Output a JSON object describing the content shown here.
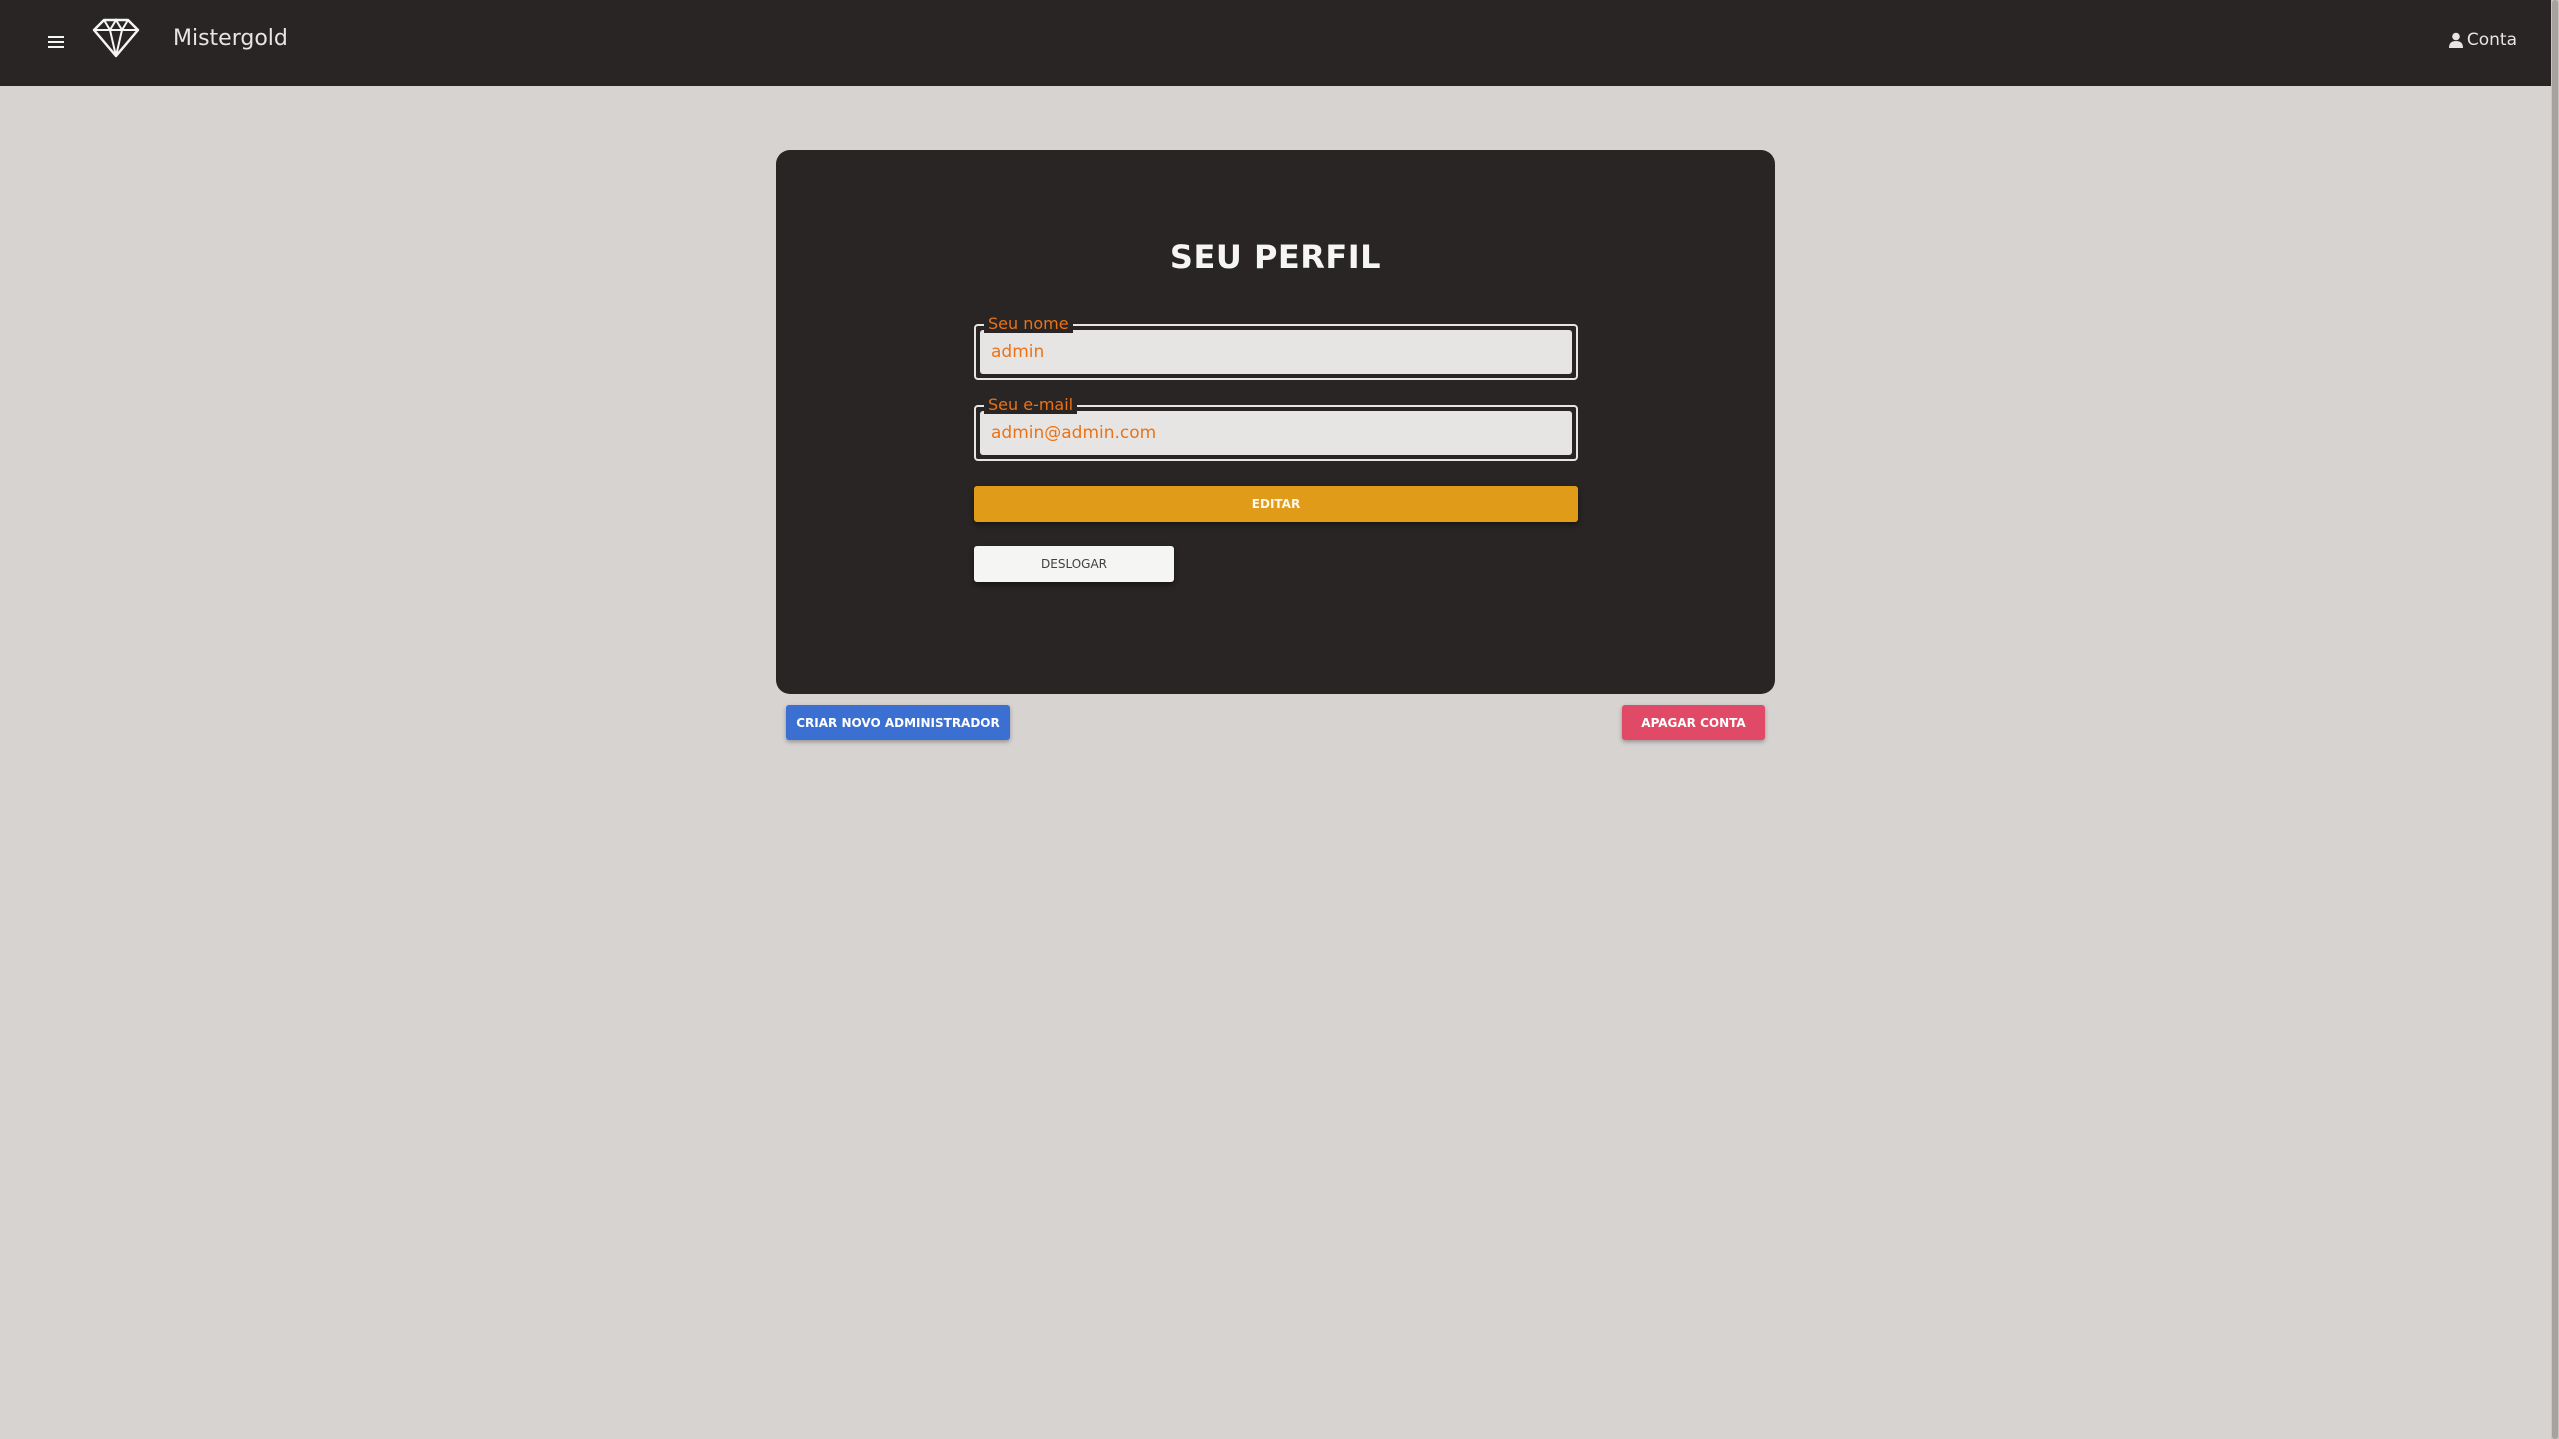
{
  "header": {
    "brand": "Mistergold",
    "account_label": "Conta",
    "menu_icon": "hamburger-menu-icon",
    "logo_icon": "diamond-logo-icon",
    "account_icon": "user-icon"
  },
  "profile": {
    "title": "SEU PERFIL",
    "name_label": "Seu nome",
    "name_value": "admin",
    "email_label": "Seu e-mail",
    "email_value": "admin@admin.com",
    "edit_button": "EDITAR",
    "logout_button": "DESLOGAR"
  },
  "actions": {
    "new_admin_button": "CRIAR NOVO ADMINISTRADOR",
    "delete_account_button": "APAGAR CONTA"
  },
  "colors": {
    "header_bg": "#292524",
    "page_bg": "#d6d3d1",
    "card_bg": "#292524",
    "accent_orange": "#ea7317",
    "edit_button": "#e09c18",
    "new_admin_button": "#3b6fd1",
    "delete_button": "#e04a66"
  }
}
